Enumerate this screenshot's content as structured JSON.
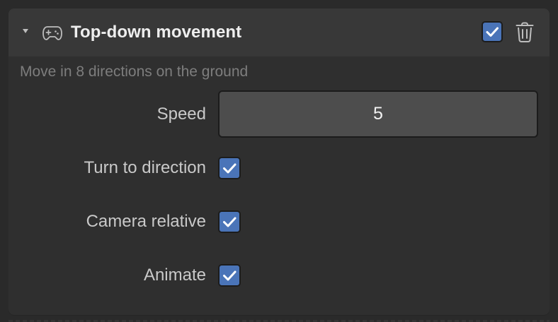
{
  "component": {
    "title": "Top-down movement",
    "description": "Move in 8 directions on the ground",
    "enabled": true,
    "icons": {
      "collapse": "chevron-down-icon",
      "type": "gamepad-icon",
      "delete": "trash-icon",
      "check": "checkmark-icon"
    }
  },
  "fields": {
    "speed": {
      "label": "Speed",
      "value": "5"
    },
    "turn_to_direction": {
      "label": "Turn to direction",
      "checked": true
    },
    "camera_relative": {
      "label": "Camera relative",
      "checked": true
    },
    "animate": {
      "label": "Animate",
      "checked": true
    }
  },
  "colors": {
    "background": "#2a2a2a",
    "panel": "#2f2f2f",
    "header": "#383838",
    "accent": "#4a74b8",
    "input": "#4d4d4d",
    "text_primary": "#eeeeee",
    "text_label": "#c9c9c9",
    "text_muted": "#7d7d7d"
  }
}
